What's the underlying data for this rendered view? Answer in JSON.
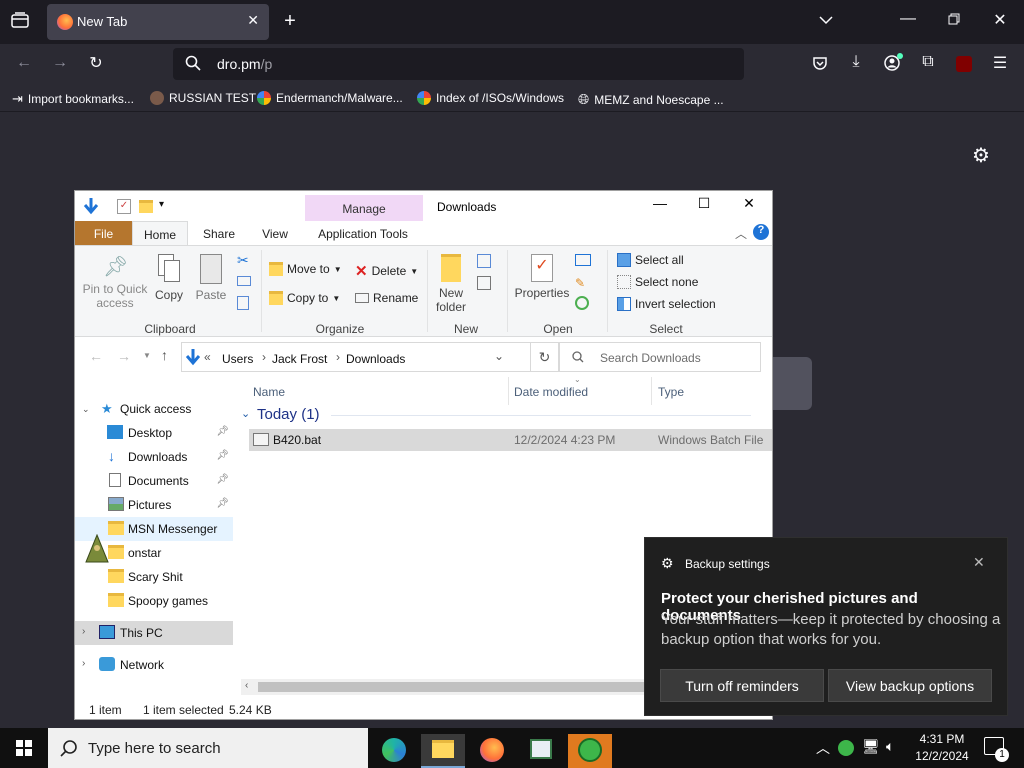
{
  "browser": {
    "tab_title": "New Tab",
    "url_host": "dro.pm",
    "url_path": "/p",
    "bookmarks": [
      "Import bookmarks...",
      "RUSSIAN TEST",
      "Endermanch/Malware...",
      "Index of /ISOs/Windows",
      "MEMZ and Noescape ..."
    ]
  },
  "explorer": {
    "window_title": "Downloads",
    "manage_label": "Manage",
    "tabs": [
      "File",
      "Home",
      "Share",
      "View",
      "Application Tools"
    ],
    "ribbon": {
      "pin_label": "Pin to Quick access",
      "copy_label": "Copy",
      "paste_label": "Paste",
      "clipboard_group": "Clipboard",
      "move_to": "Move to",
      "copy_to": "Copy to",
      "delete": "Delete",
      "rename": "Rename",
      "organize_group": "Organize",
      "new_folder": "New folder",
      "new_group": "New",
      "properties": "Properties",
      "open_group": "Open",
      "select_all": "Select all",
      "select_none": "Select none",
      "invert_selection": "Invert selection",
      "select_group": "Select"
    },
    "address": {
      "crumbs": [
        "Users",
        "Jack Frost",
        "Downloads"
      ],
      "search_placeholder": "Search Downloads"
    },
    "nav": {
      "quick_access": "Quick access",
      "items": [
        "Desktop",
        "Downloads",
        "Documents",
        "Pictures",
        "MSN Messenger",
        "onstar",
        "Scary Shit",
        "Spoopy games"
      ],
      "this_pc": "This PC",
      "network": "Network"
    },
    "columns": [
      "Name",
      "Date modified",
      "Type"
    ],
    "group_header": "Today (1)",
    "files": [
      {
        "name": "B420.bat",
        "date": "12/2/2024 4:23 PM",
        "type": "Windows Batch File"
      }
    ],
    "status": {
      "count": "1 item",
      "selected": "1 item selected",
      "size": "5.24 KB"
    }
  },
  "toast": {
    "app": "Backup settings",
    "title": "Protect your cherished pictures and documents",
    "body": "Your stuff matters—keep it protected by choosing a backup option that works for you.",
    "btn_off": "Turn off reminders",
    "btn_view": "View backup options"
  },
  "taskbar": {
    "search_placeholder": "Type here to search",
    "time": "4:31 PM",
    "date": "12/2/2024",
    "notif_count": "1"
  },
  "colors": {
    "browser_bg": "#2b2a33",
    "file_tab": "#b5762e",
    "manage_tab": "#f1d8f6",
    "toast_bg": "#1f1f1f"
  }
}
